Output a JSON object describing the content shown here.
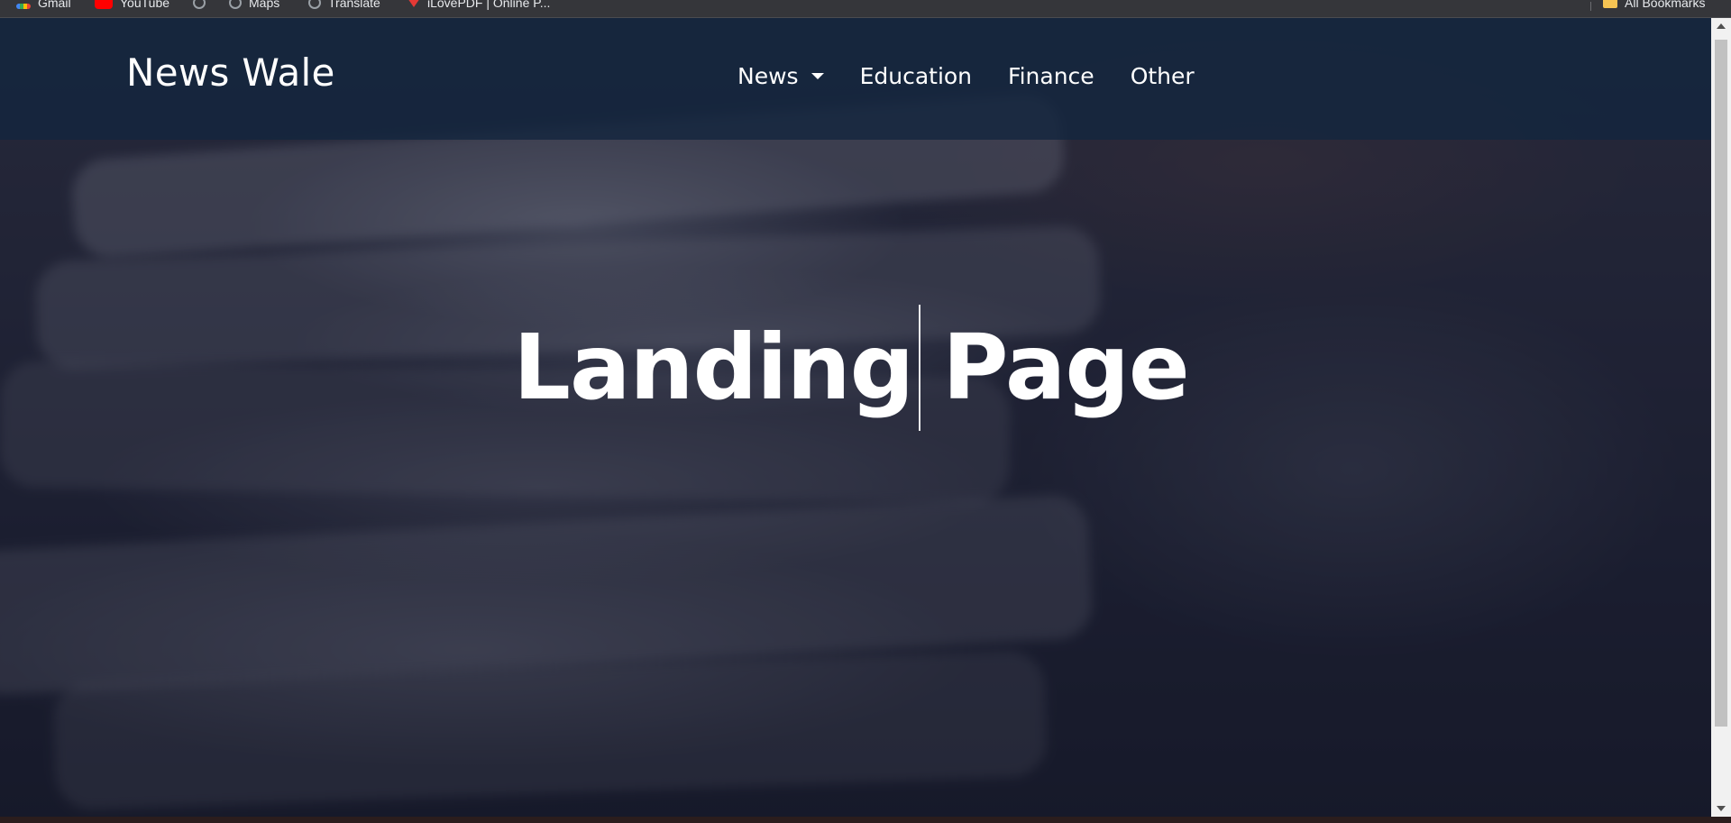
{
  "bookmarks": [
    {
      "label": "Gmail",
      "icon": "gmail-icon"
    },
    {
      "label": "YouTube",
      "icon": "youtube-icon"
    },
    {
      "label": "",
      "icon": "globe-icon"
    },
    {
      "label": "Maps",
      "icon": "globe-icon"
    },
    {
      "label": "Translate",
      "icon": "globe-icon"
    },
    {
      "label": "iLovePDF | Online P...",
      "icon": "ilovepdf-icon"
    }
  ],
  "all_bookmarks": {
    "label": "All Bookmarks",
    "icon": "folder-icon"
  },
  "navbar": {
    "brand": "News Wale",
    "links": [
      {
        "label": "News",
        "has_dropdown": true
      },
      {
        "label": "Education"
      },
      {
        "label": "Finance"
      },
      {
        "label": "Other"
      }
    ]
  },
  "hero": {
    "word1": "Landing",
    "word2": "Page"
  },
  "colors": {
    "navbar_bg": "#14263e",
    "hero_overlay": "#161a2d",
    "text": "#ffffff"
  }
}
